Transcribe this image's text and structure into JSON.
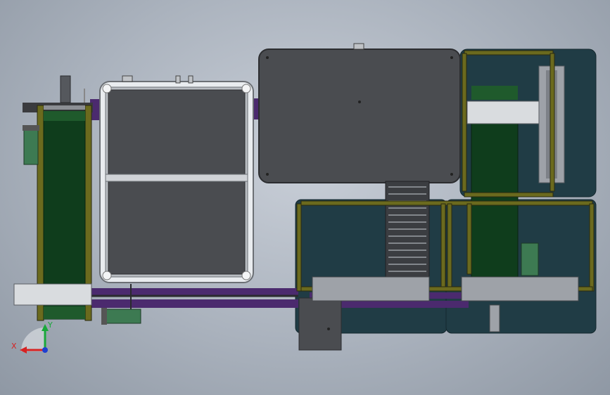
{
  "title": "",
  "colors": {
    "background_center": "#c9cfd8",
    "background_edge": "#8f98a4",
    "plate": "#4a4c50",
    "plate_edge": "#2c2d30",
    "belt": "#0f3d1c",
    "belt_edge": "#0a2410",
    "guard_teal": "#203c45",
    "rail_purple": "#4b2a6e",
    "rail_yellow": "#6b6a1e",
    "frame_white": "#e9ecef",
    "motor_green": "#3d7a52",
    "axis_x": "#d62222",
    "axis_y": "#19a83a",
    "axis_z": "#1f3fd0"
  },
  "axes": {
    "x_label": "X",
    "y_label": "Y"
  },
  "components": [
    "left-belt-conveyor",
    "crate-frame-station",
    "top-plate-station",
    "center-roller-conveyor",
    "right-belt-conveyor",
    "guard-cells",
    "purple-transfer-rails",
    "drive-motors"
  ]
}
